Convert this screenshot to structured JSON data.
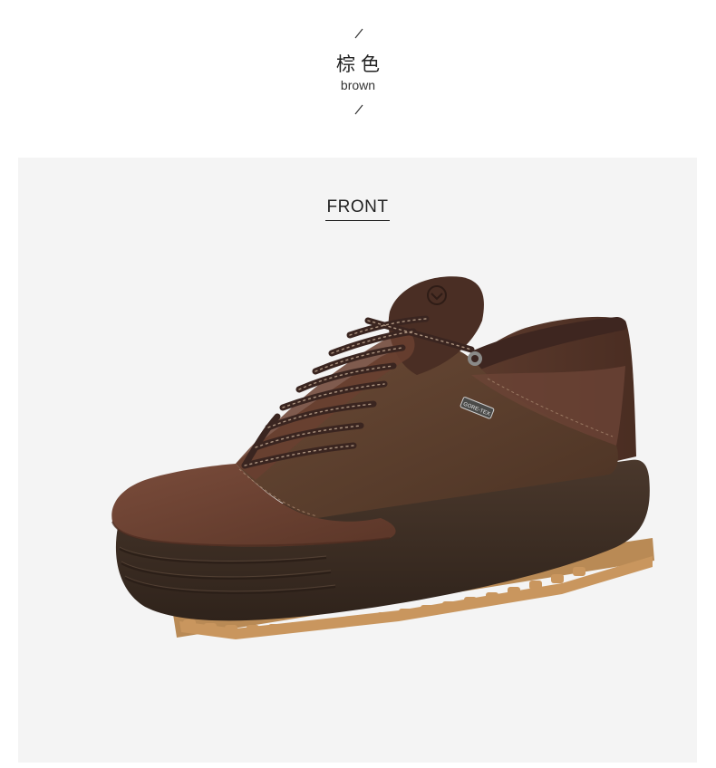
{
  "header": {
    "color_name_cn": "棕色",
    "color_name_en": "brown"
  },
  "view": {
    "label": "FRONT"
  },
  "product": {
    "logo_text": "GORE-TEX",
    "colors": {
      "upper_suede": "#6b4133",
      "upper_leather": "#5a3e2e",
      "collar": "#3e2620",
      "sole_dark": "#3f2f25",
      "sole_gum": "#c9965e",
      "lace": "#3a2520",
      "lace_highlight": "#b9a08a"
    }
  }
}
